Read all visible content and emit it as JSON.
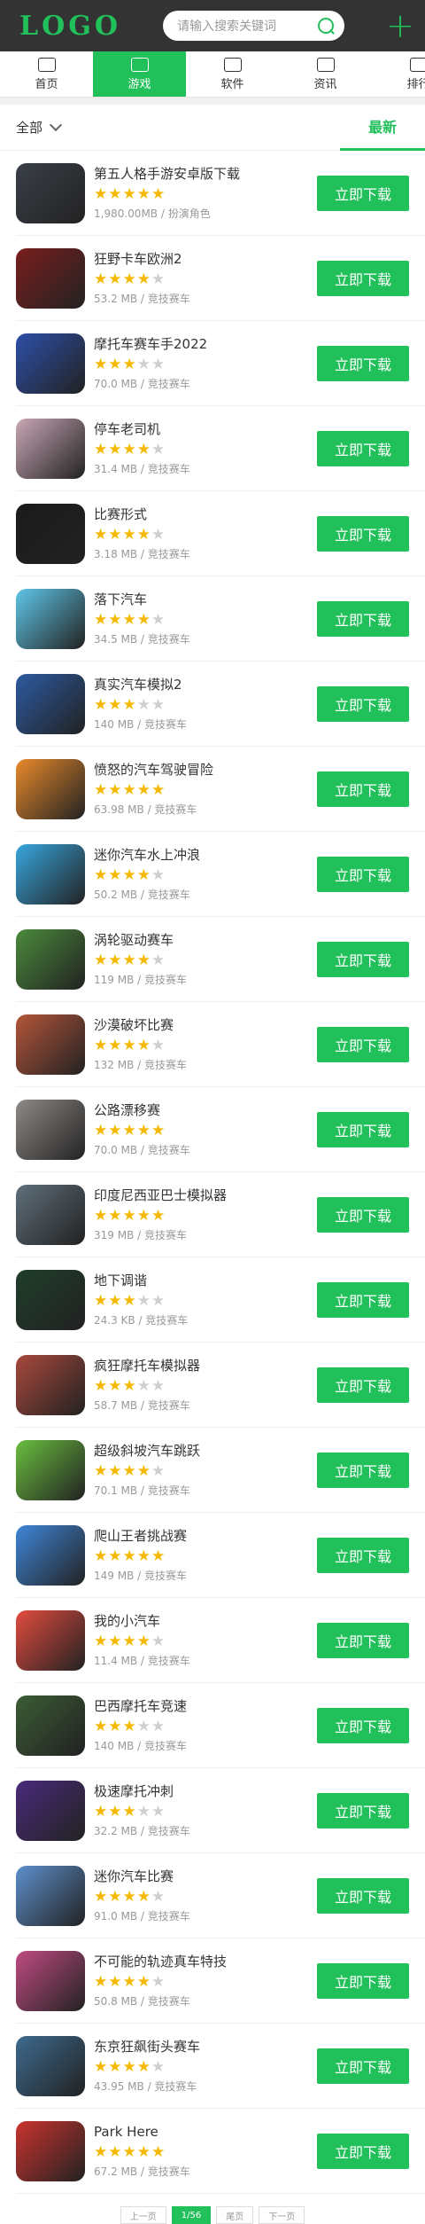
{
  "header": {
    "logo": "LOGO",
    "search_placeholder": "请输入搜索关键词"
  },
  "nav": [
    {
      "label": "首页",
      "icon": "home-icon",
      "active": false
    },
    {
      "label": "游戏",
      "icon": "gamepad-icon",
      "active": true
    },
    {
      "label": "软件",
      "icon": "apps-icon",
      "active": false
    },
    {
      "label": "资讯",
      "icon": "news-icon",
      "active": false
    },
    {
      "label": "排行",
      "icon": "ranking-icon",
      "active": false
    }
  ],
  "filter": {
    "category": "全部",
    "tab": "最新"
  },
  "download_label": "立即下载",
  "apps": [
    {
      "name": "第五人格手游安卓版下载",
      "stars": 5,
      "meta": "1,980.00MB / 扮演角色",
      "color": "#3a3f48"
    },
    {
      "name": "狂野卡车欧洲2",
      "stars": 4,
      "meta": "53.2 MB / 竞技赛车",
      "color": "#7a1e1e"
    },
    {
      "name": "摩托车赛车手2022",
      "stars": 3,
      "meta": "70.0 MB / 竞技赛车",
      "color": "#2d4fa8"
    },
    {
      "name": "停车老司机",
      "stars": 4,
      "meta": "31.4 MB / 竞技赛车",
      "color": "#c9a7b5"
    },
    {
      "name": "比赛形式",
      "stars": 4,
      "meta": "3.18 MB / 竞技赛车",
      "color": "#1a1a1a"
    },
    {
      "name": "落下汽车",
      "stars": 4,
      "meta": "34.5 MB / 竞技赛车",
      "color": "#5ec6e8"
    },
    {
      "name": "真实汽车模拟2",
      "stars": 3,
      "meta": "140 MB / 竞技赛车",
      "color": "#2c5aa0"
    },
    {
      "name": "愤怒的汽车驾驶冒险",
      "stars": 5,
      "meta": "63.98 MB / 竞技赛车",
      "color": "#e8892b"
    },
    {
      "name": "迷你汽车水上冲浪",
      "stars": 4,
      "meta": "50.2 MB / 竞技赛车",
      "color": "#37a6de"
    },
    {
      "name": "涡轮驱动赛车",
      "stars": 4,
      "meta": "119 MB / 竞技赛车",
      "color": "#4b8a3c"
    },
    {
      "name": "沙漠破坏比赛",
      "stars": 4,
      "meta": "132 MB / 竞技赛车",
      "color": "#b4553a"
    },
    {
      "name": "公路漂移赛",
      "stars": 5,
      "meta": "70.0 MB / 竞技赛车",
      "color": "#8e8a86"
    },
    {
      "name": "印度尼西亚巴士模拟器",
      "stars": 5,
      "meta": "319 MB / 竞技赛车",
      "color": "#5f6f7a"
    },
    {
      "name": "地下调谐",
      "stars": 3,
      "meta": "24.3 KB / 竞技赛车",
      "color": "#1f3d2a"
    },
    {
      "name": "疯狂摩托车模拟器",
      "stars": 3,
      "meta": "58.7 MB / 竞技赛车",
      "color": "#a8483c"
    },
    {
      "name": "超级斜坡汽车跳跃",
      "stars": 4,
      "meta": "70.1 MB / 竞技赛车",
      "color": "#6abe3f"
    },
    {
      "name": "爬山王者挑战赛",
      "stars": 5,
      "meta": "149 MB / 竞技赛车",
      "color": "#3f86d8"
    },
    {
      "name": "我的小汽车",
      "stars": 4,
      "meta": "11.4 MB / 竞技赛车",
      "color": "#e24b3f"
    },
    {
      "name": "巴西摩托车竞速",
      "stars": 3,
      "meta": "140 MB / 竞技赛车",
      "color": "#3b5c35"
    },
    {
      "name": "极速摩托冲刺",
      "stars": 3,
      "meta": "32.2 MB / 竞技赛车",
      "color": "#4a2a7a"
    },
    {
      "name": "迷你汽车比赛",
      "stars": 4,
      "meta": "91.0 MB / 竞技赛车",
      "color": "#5d8fcc"
    },
    {
      "name": "不可能的轨迹真车特技",
      "stars": 4,
      "meta": "50.8 MB / 竞技赛车",
      "color": "#c04b82"
    },
    {
      "name": "东京狂飙街头赛车",
      "stars": 4,
      "meta": "43.95 MB / 竞技赛车",
      "color": "#3d6a8e"
    },
    {
      "name": "Park Here",
      "stars": 5,
      "meta": "67.2 MB / 竞技赛车",
      "color": "#c9332e"
    }
  ],
  "pagination": {
    "prev": "上一页",
    "current": "1/56",
    "last": "尾页",
    "next": "下一页"
  }
}
